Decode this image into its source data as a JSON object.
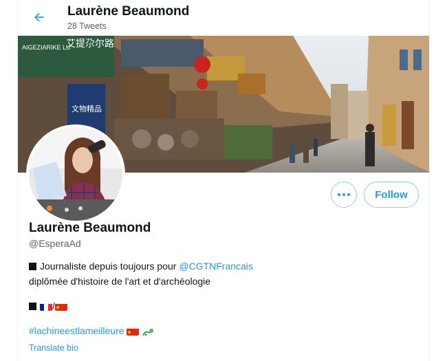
{
  "header": {
    "name": "Laurène Beaumond",
    "tweets": "28 Tweets"
  },
  "profile": {
    "display_name": "Laurène Beaumond",
    "handle": "@EsperaAd",
    "follow_label": "Follow",
    "bio": {
      "line1_text": "Journaliste depuis toujours pour",
      "line1_mention": "@CGTNFrancais",
      "line2": "diplômée d'histoire de l'art et d'archéologie",
      "line3_sep": "/",
      "hashtag": "#lachineestlameilleure"
    },
    "translate_label": "Translate bio"
  },
  "banner": {
    "sign_top": "AIGEZIARIKE LU",
    "sign_cjk": "艾提尕尔路",
    "sign_vertical": "文物精品"
  },
  "colors": {
    "accent": "#1d9bf0",
    "follow_border": "#8ecdf8",
    "secondary_text": "#536471"
  },
  "icons": {
    "back": "arrow-left-icon",
    "more": "more-dots-icon"
  }
}
